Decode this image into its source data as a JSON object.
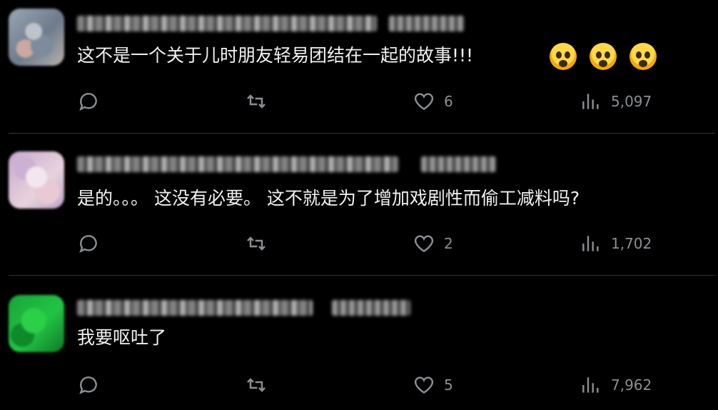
{
  "replies": [
    {
      "text": "这不是一个关于儿时朋友轻易团结在一起的故事!!!",
      "emojis": [
        "scream-emoji",
        "scream-emoji",
        "scream-emoji"
      ],
      "likes": "6",
      "views": "5,097"
    },
    {
      "text": "是的。。。 这没有必要。 这不就是为了增加戏剧性而偷工减料吗?",
      "likes": "2",
      "views": "1,702"
    },
    {
      "text": "我要呕吐了",
      "likes": "5",
      "views": "7,962"
    }
  ],
  "colors": {
    "background": "#000000",
    "text": "#e7e9ea",
    "icon": "#8b8f94",
    "divider": "#2f3336"
  }
}
